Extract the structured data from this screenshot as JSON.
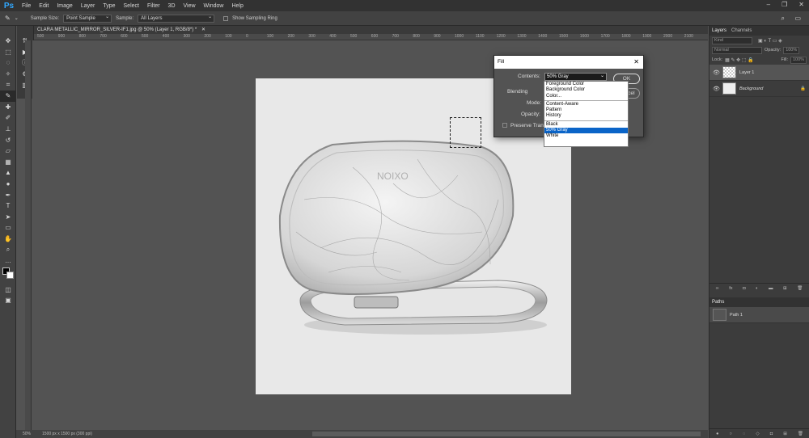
{
  "app": {
    "logo": "Ps"
  },
  "menu": [
    "File",
    "Edit",
    "Image",
    "Layer",
    "Type",
    "Select",
    "Filter",
    "3D",
    "View",
    "Window",
    "Help"
  ],
  "options": {
    "sample_size_label": "Sample Size:",
    "sample_size_value": "Point Sample",
    "sample_label": "Sample:",
    "sample_value": "All Layers",
    "show_ring_label": "Show Sampling Ring"
  },
  "document": {
    "tab_title": "CLARA METALLIC_MIRROR_SILVER-IF1.jpg @ 50% (Layer 1, RGB/8*) *",
    "zoom": "50%",
    "dimensions": "1500 px x 1500 px (300 ppi)"
  },
  "ruler_ticks": [
    "500",
    "900",
    "800",
    "700",
    "600",
    "500",
    "400",
    "300",
    "200",
    "100",
    "0",
    "100",
    "200",
    "300",
    "400",
    "500",
    "600",
    "700",
    "800",
    "900",
    "1000",
    "1100",
    "1200",
    "1300",
    "1400",
    "1500",
    "1600",
    "1700",
    "1800",
    "1900",
    "2000",
    "2100"
  ],
  "layers_panel": {
    "tabs": [
      "Layers",
      "Channels"
    ],
    "kind_placeholder": "Kind",
    "blend_mode": "Normal",
    "opacity_label": "Opacity:",
    "opacity_value": "100%",
    "lock_label": "Lock:",
    "fill_label": "Fill:",
    "fill_value": "100%",
    "layers": [
      {
        "name": "Layer 1",
        "selected": true
      },
      {
        "name": "Background",
        "selected": false
      }
    ]
  },
  "paths_panel": {
    "tab": "Paths",
    "paths": [
      "Path 1"
    ]
  },
  "fill_dialog": {
    "title": "Fill",
    "contents_label": "Contents:",
    "contents_value": "50% Gray",
    "blending_label": "Blending",
    "mode_label": "Mode:",
    "opacity_label": "Opacity:",
    "preserve_label": "Preserve Tran",
    "ok_label": "OK",
    "cancel_label": "Cancel",
    "options_group1": [
      "Foreground Color",
      "Background Color",
      "Color..."
    ],
    "options_group2": [
      "Content-Aware",
      "Pattern",
      "History"
    ],
    "options_group3": [
      "Black",
      "50% Gray",
      "White"
    ],
    "selected_option": "50% Gray",
    "highlight_color": "#0a64c8"
  }
}
